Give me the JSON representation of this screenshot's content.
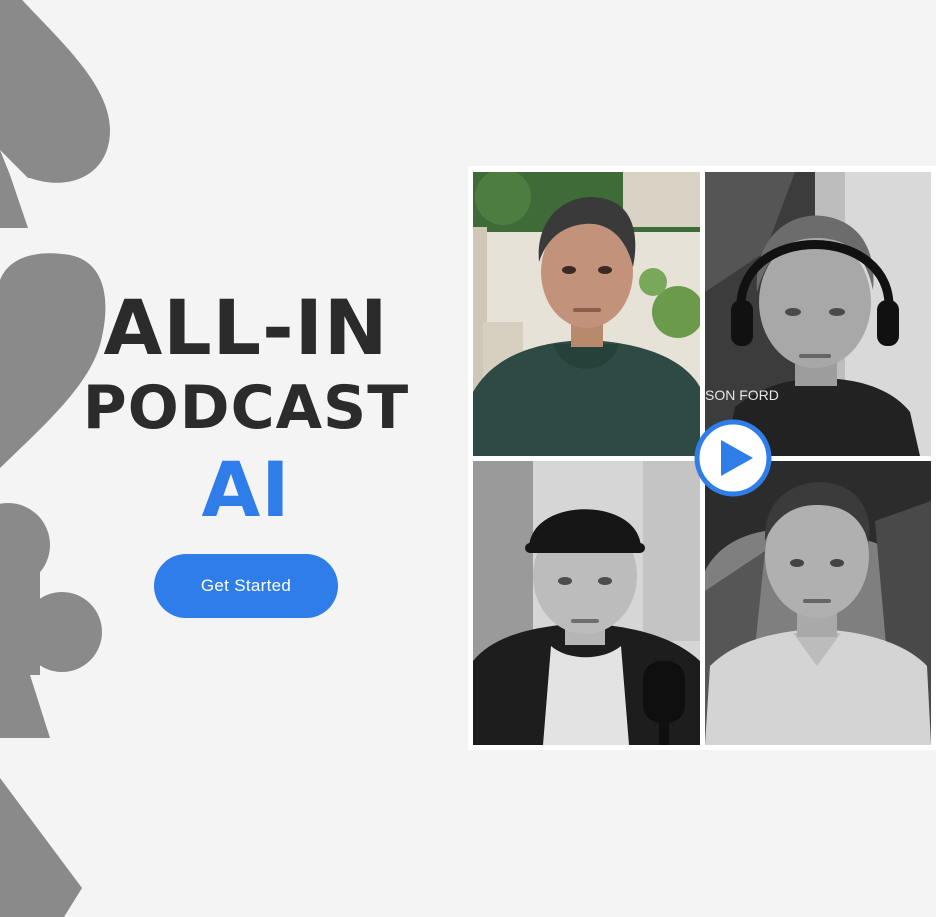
{
  "hero": {
    "title_line1": "ALL-IN",
    "title_line2": "PODCAST",
    "title_line3": "AI",
    "cta_label": "Get Started"
  },
  "video_grid": {
    "poster_text": "SON FORD",
    "play_icon": "play-icon"
  },
  "colors": {
    "accent": "#2f7de8",
    "title": "#2b2b2b",
    "background": "#f4f4f5",
    "suit_shapes": "#8a8a8a"
  },
  "decor": {
    "icons": [
      "spade-icon",
      "heart-icon",
      "club-icon",
      "diamond-icon"
    ]
  }
}
